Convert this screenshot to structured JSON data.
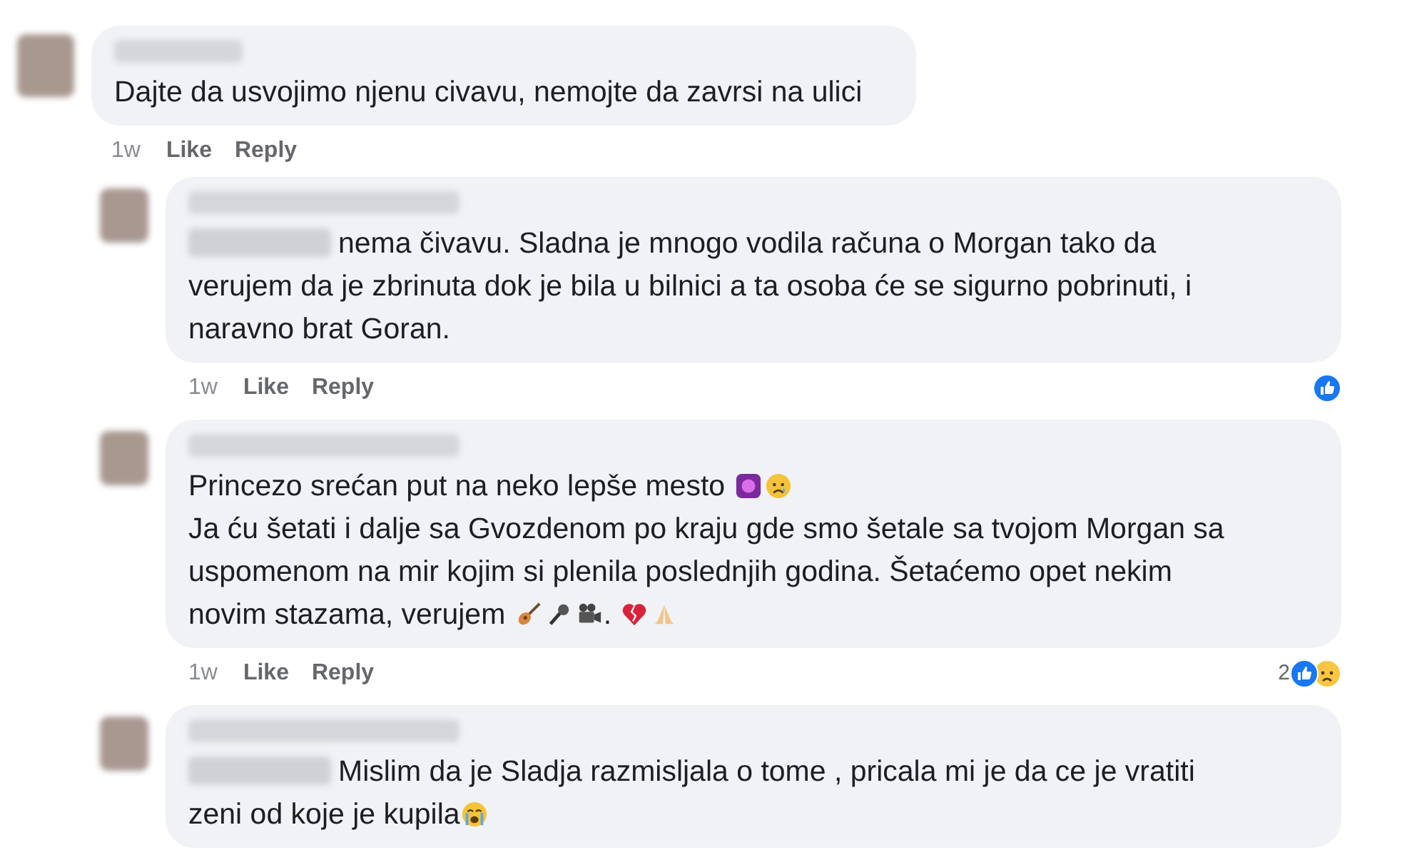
{
  "comments": [
    {
      "mention_blurred": false,
      "body": [
        {
          "kind": "text",
          "text": "Dajte da usvojimo njenu civavu, nemojte da zavrsi na ulici"
        }
      ],
      "meta": {
        "time": "1w",
        "actions": [
          "Like",
          "Reply"
        ]
      },
      "replies": [
        {
          "mention_blurred": true,
          "body": [
            {
              "kind": "text",
              "text": "nema čivavu. Sladna je mnogo vodila računa o Morgan tako da verujem da je zbrinuta dok je bila u bilnici a ta osoba će se sigurno pobrinuti, i naravno brat Goran."
            }
          ],
          "meta": {
            "time": "1w",
            "actions": [
              "Like",
              "Reply"
            ],
            "reactions": {
              "icons": [
                {
                  "kind": "like"
                }
              ]
            }
          }
        },
        {
          "mention_blurred": false,
          "body": [
            {
              "kind": "text",
              "text": "Princezo srećan put na neko lepše mesto "
            },
            {
              "kind": "purple-square"
            },
            {
              "kind": "sad"
            },
            {
              "kind": "break"
            },
            {
              "kind": "text",
              "text": "Ja ću šetati i dalje sa Gvozdenom po kraju gde smo šetale sa tvojom Morgan sa uspomenom na mir kojim si plenila poslednjih godina. Šetaćemo opet nekim novim stazama, verujem "
            },
            {
              "kind": "guitar"
            },
            {
              "kind": "mic"
            },
            {
              "kind": "camera"
            },
            {
              "kind": "text",
              "text": ". "
            },
            {
              "kind": "broken-heart"
            },
            {
              "kind": "pray"
            }
          ],
          "meta": {
            "time": "1w",
            "actions": [
              "Like",
              "Reply"
            ],
            "reactions": {
              "count": "2",
              "icons": [
                {
                  "kind": "like"
                },
                {
                  "kind": "sad"
                }
              ]
            }
          }
        },
        {
          "mention_blurred": true,
          "body": [
            {
              "kind": "text",
              "text": "Mislim da je Sladja razmisljala o tome , pricala mi je da ce je vratiti zeni od koje je kupila"
            },
            {
              "kind": "cry"
            }
          ]
        }
      ]
    }
  ]
}
